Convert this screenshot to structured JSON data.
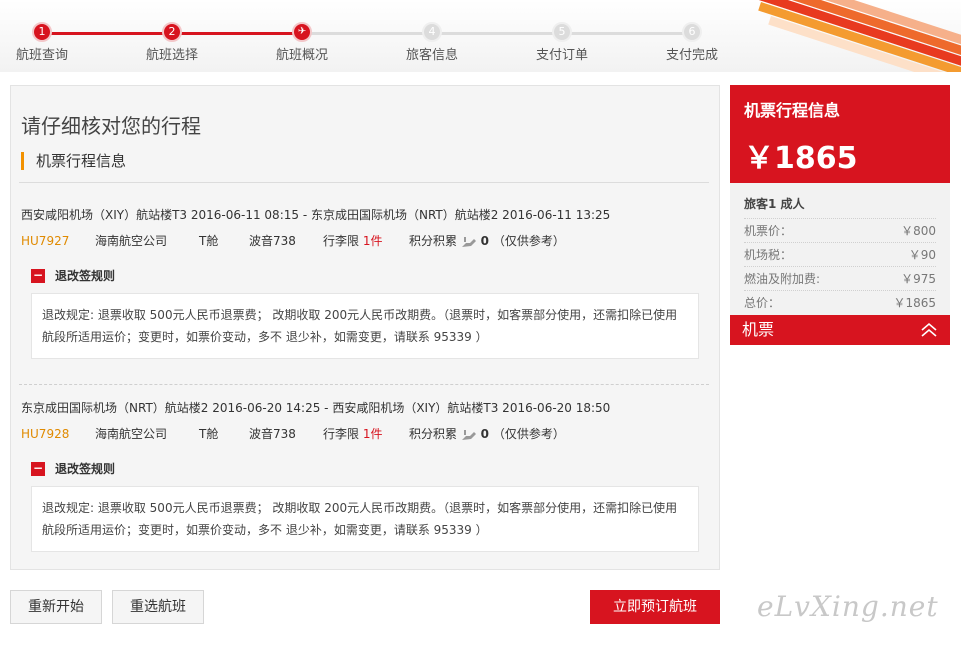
{
  "steps": [
    {
      "num": "1",
      "label": "航班查询",
      "state": "done"
    },
    {
      "num": "2",
      "label": "航班选择",
      "state": "done"
    },
    {
      "num": "✈",
      "label": "航班概况",
      "state": "current"
    },
    {
      "num": "4",
      "label": "旅客信息",
      "state": "todo"
    },
    {
      "num": "5",
      "label": "支付订单",
      "state": "todo"
    },
    {
      "num": "6",
      "label": "支付完成",
      "state": "todo"
    }
  ],
  "main": {
    "title": "请仔细核对您的行程",
    "section_title": "机票行程信息"
  },
  "segments": [
    {
      "route": "西安咸阳机场（XIY）航站楼T3 2016-06-11 08:15 - 东京成田国际机场（NRT）航站楼2 2016-06-11 13:25",
      "flight_no": "HU7927",
      "airline": "海南航空公司",
      "cabin": "T舱",
      "plane": "波音738",
      "baggage_label": "行李限",
      "baggage_value": "1件",
      "points_label": "积分积累",
      "points_value": "0",
      "points_note": "（仅供参考）",
      "rules_title": "退改签规则",
      "rules_line1": "退改规定: 退票收取 500元人民币退票费； 改期收取 200元人民币改期费。（退票时，如客票部分使用，还需扣除已使用",
      "rules_line2": "航段所适用运价；变更时，如票价变动，多不 退少补，如需变更，请联系 95339 ）"
    },
    {
      "route": "东京成田国际机场（NRT）航站楼2 2016-06-20 14:25 - 西安咸阳机场（XIY）航站楼T3 2016-06-20 18:50",
      "flight_no": "HU7928",
      "airline": "海南航空公司",
      "cabin": "T舱",
      "plane": "波音738",
      "baggage_label": "行李限",
      "baggage_value": "1件",
      "points_label": "积分积累",
      "points_value": "0",
      "points_note": "（仅供参考）",
      "rules_title": "退改签规则",
      "rules_line1": "退改规定: 退票收取 500元人民币退票费； 改期收取 200元人民币改期费。（退票时，如客票部分使用，还需扣除已使用",
      "rules_line2": "航段所适用运价；变更时，如票价变动，多不 退少补，如需变更，请联系 95339 ）"
    }
  ],
  "buttons": {
    "restart": "重新开始",
    "reselect": "重选航班",
    "book": "立即预订航班"
  },
  "side": {
    "title": "机票行程信息",
    "price": "￥1865",
    "passenger": "旅客1  成人",
    "rows": [
      {
        "label": "机票价：",
        "value": "￥800"
      },
      {
        "label": "机场税：",
        "value": "￥90"
      },
      {
        "label": "燃油及附加费:",
        "value": "￥975"
      },
      {
        "label": "总价：",
        "value": "￥1865"
      }
    ],
    "footer": "机票"
  },
  "brand": "eLvXing.net",
  "colors": {
    "accent": "#d7141f",
    "flight_no": "#e08a00",
    "section_marker": "#f29100"
  }
}
